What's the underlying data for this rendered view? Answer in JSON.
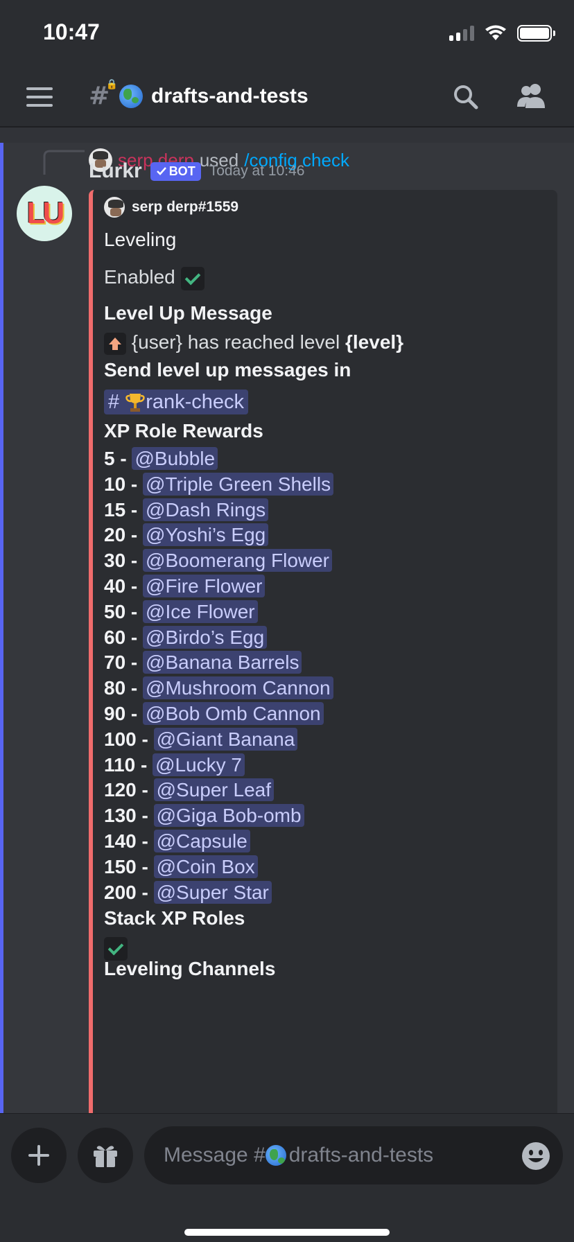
{
  "status": {
    "time": "10:47"
  },
  "header": {
    "channel_name": "drafts-and-tests"
  },
  "reply": {
    "user": "serp derp",
    "used": "used",
    "command": "/config check"
  },
  "message": {
    "author": "Lurkr",
    "bot_tag": "BOT",
    "timestamp": "Today at 10:46",
    "avatar_text": "LU"
  },
  "embed": {
    "author": "serp derp#1559",
    "leveling_title": "Leveling",
    "enabled_text": "Enabled",
    "level_up_title": "Level Up Message",
    "level_up_prefix": "{user} has reached level ",
    "level_up_bold": "{level}",
    "send_in_title": "Send level up messages in",
    "send_in_hash": "#",
    "send_in_channel": "rank-check",
    "rewards_title": "XP Role Rewards",
    "rewards": [
      {
        "level": "5 - ",
        "role": "@Bubble"
      },
      {
        "level": "10 - ",
        "role": "@Triple Green Shells"
      },
      {
        "level": "15 - ",
        "role": "@Dash Rings"
      },
      {
        "level": "20 - ",
        "role": "@Yoshi’s Egg"
      },
      {
        "level": "30 - ",
        "role": "@Boomerang Flower"
      },
      {
        "level": "40 - ",
        "role": "@Fire Flower"
      },
      {
        "level": "50 - ",
        "role": "@Ice Flower"
      },
      {
        "level": "60 - ",
        "role": "@Birdo’s Egg"
      },
      {
        "level": "70 - ",
        "role": "@Banana Barrels"
      },
      {
        "level": "80 - ",
        "role": "@Mushroom Cannon"
      },
      {
        "level": "90 - ",
        "role": "@Bob Omb Cannon"
      },
      {
        "level": "100 - ",
        "role": "@Giant Banana"
      },
      {
        "level": "110 - ",
        "role": "@Lucky 7"
      },
      {
        "level": "120 - ",
        "role": "@Super Leaf"
      },
      {
        "level": "130 - ",
        "role": "@Giga Bob-omb"
      },
      {
        "level": "140 - ",
        "role": "@Capsule"
      },
      {
        "level": "150 - ",
        "role": "@Coin Box"
      },
      {
        "level": "200 - ",
        "role": "@Super Star"
      }
    ],
    "stack_title": "Stack XP Roles",
    "channels_title": "Leveling Channels"
  },
  "composer": {
    "placeholder_prefix": "Message #",
    "placeholder_channel": "drafts-and-tests"
  },
  "colors": {
    "accent": "#5865f2",
    "embed_bar": "#f06c6c",
    "mention_bg": "#3c4270"
  }
}
